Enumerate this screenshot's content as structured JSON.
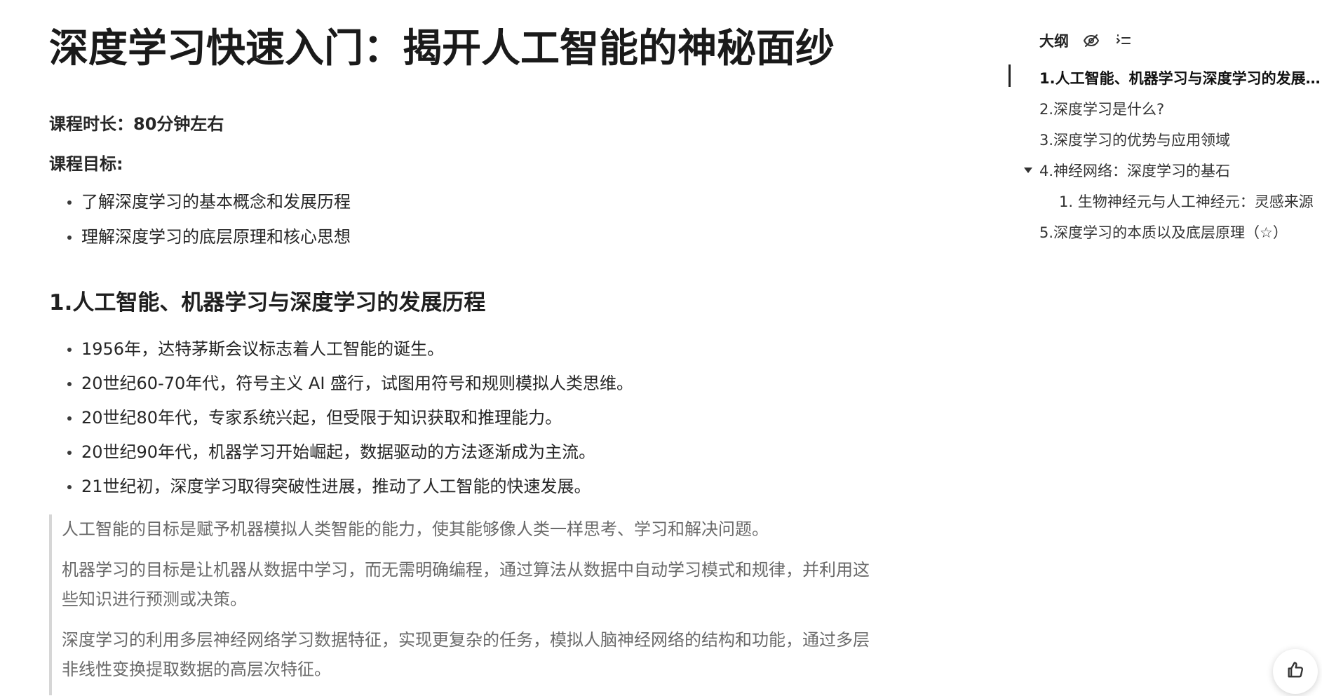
{
  "document": {
    "title": "深度学习快速入门：揭开人工智能的神秘面纱",
    "duration": "课程时长：80分钟左右",
    "goal_label": "课程目标:",
    "goals": [
      "了解深度学习的基本概念和发展历程",
      "理解深度学习的底层原理和核心思想"
    ],
    "section1": {
      "heading": "1.人工智能、机器学习与深度学习的发展历程",
      "history": [
        "1956年，达特茅斯会议标志着人工智能的诞生。",
        "20世纪60-70年代，符号主义 AI 盛行，试图用符号和规则模拟人类思维。",
        "20世纪80年代，专家系统兴起，但受限于知识获取和推理能力。",
        "20世纪90年代，机器学习开始崛起，数据驱动的方法逐渐成为主流。",
        "21世纪初，深度学习取得突破性进展，推动了人工智能的快速发展。"
      ],
      "quotes": [
        "人工智能的目标是赋予机器模拟人类智能的能力，使其能够像人类一样思考、学习和解决问题。",
        "机器学习的目标是让机器从数据中学习，而无需明确编程，通过算法从数据中自动学习模式和规律，并利用这些知识进行预测或决策。",
        "深度学习的利用多层神经网络学习数据特征，实现更复杂的任务，模拟人脑神经网络的结构和功能，通过多层非线性变换提取数据的高层次特征。"
      ]
    }
  },
  "outline": {
    "title": "大纲",
    "icons": [
      "eye-off-icon",
      "list-indent-icon"
    ],
    "items": [
      {
        "label": "1.人工智能、机器学习与深度学习的发展历程",
        "active": true
      },
      {
        "label": "2.深度学习是什么?"
      },
      {
        "label": "3.深度学习的优势与应用领域"
      },
      {
        "label": "4.神经网络：深度学习的基石",
        "expanded": true
      },
      {
        "label": "1. 生物神经元与人工神经元：灵感来源",
        "level": 2
      },
      {
        "label": "5.深度学习的本质以及底层原理（☆）"
      }
    ]
  },
  "floating": {
    "like_icon": "thumbs-up-icon"
  },
  "colors": {
    "text": "#1f1f1f",
    "quote_text": "#6a6a6a",
    "quote_border": "#d6d6d6",
    "outline_marker": "#222222"
  }
}
